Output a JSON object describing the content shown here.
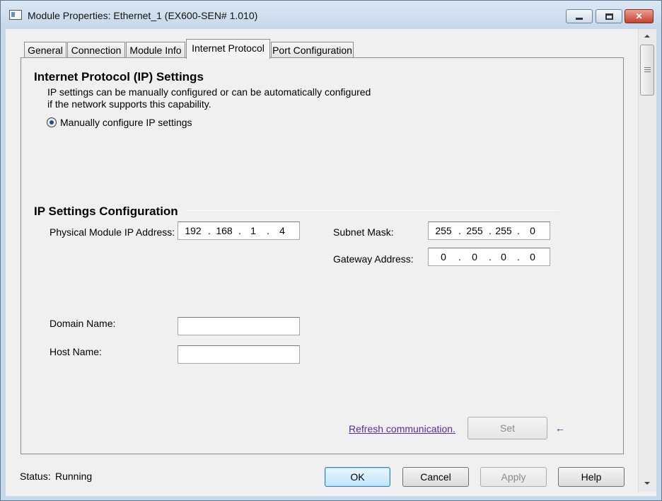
{
  "window": {
    "title": "Module Properties: Ethernet_1 (EX600-SEN# 1.010)"
  },
  "tabs": [
    {
      "label": "General"
    },
    {
      "label": "Connection"
    },
    {
      "label": "Module Info"
    },
    {
      "label": "Internet Protocol"
    },
    {
      "label": "Port Configuration"
    }
  ],
  "active_tab": "Internet Protocol",
  "ip_settings": {
    "heading": "Internet Protocol (IP) Settings",
    "description_line1": "IP settings can be manually configured or can be automatically configured",
    "description_line2": "if the network supports this capability.",
    "radio_label": "Manually configure IP settings",
    "radio_selected": true
  },
  "config": {
    "heading": "IP Settings Configuration",
    "physical_ip_label": "Physical Module IP Address:",
    "physical_ip": [
      "192",
      "168",
      "1",
      "4"
    ],
    "subnet_label": "Subnet Mask:",
    "subnet": [
      "255",
      "255",
      "255",
      "0"
    ],
    "gateway_label": "Gateway Address:",
    "gateway": [
      "0",
      "0",
      "0",
      "0"
    ],
    "domain_label": "Domain Name:",
    "domain_value": "",
    "host_label": "Host Name:",
    "host_value": "",
    "octet_separator": "."
  },
  "refresh_link": "Refresh communication.",
  "set_button": "Set",
  "status": {
    "label": "Status:",
    "value": "Running"
  },
  "buttons": {
    "ok": "OK",
    "cancel": "Cancel",
    "apply": "Apply",
    "help": "Help"
  },
  "icons": {
    "app": "module-icon",
    "minimize": "minimize-icon",
    "maximize": "maximize-icon",
    "close": "close-icon",
    "set_pointer": "arrow-left-icon"
  },
  "colors": {
    "link": "#5a2aa0",
    "title_bar": "#c6d7ea",
    "close_button": "#c7402c"
  }
}
